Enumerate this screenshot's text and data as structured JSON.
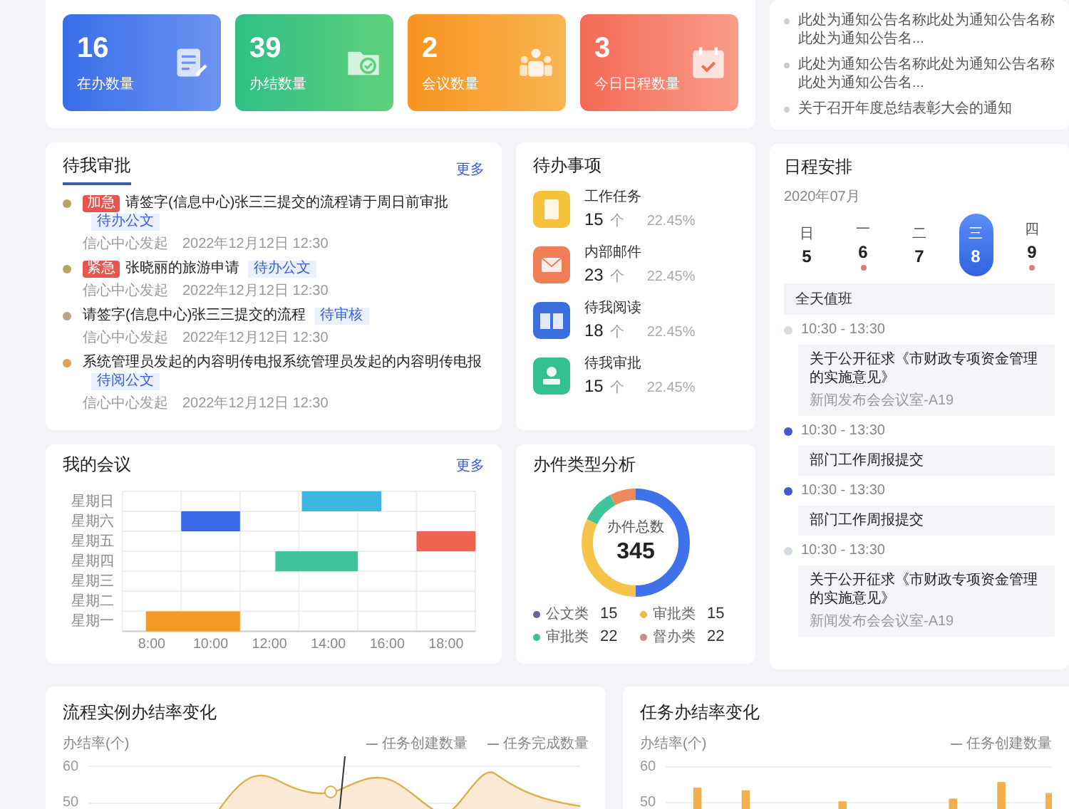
{
  "stats": [
    {
      "kind": "doing",
      "value": "16",
      "label": "在办数量"
    },
    {
      "kind": "done",
      "value": "39",
      "label": "办结数量"
    },
    {
      "kind": "meeting",
      "value": "2",
      "label": "会议数量"
    },
    {
      "kind": "schedule",
      "value": "3",
      "label": "今日日程数量"
    }
  ],
  "notices": [
    {
      "title": "此处为通知公告名称此处为通知公告名称此处为通知公告名..."
    },
    {
      "title": "此处为通知公告名称此处为通知公告名称此处为通知公告名..."
    },
    {
      "title": "关于召开年度总结表彰大会的通知"
    }
  ],
  "approvals": {
    "title": "待我审批",
    "more": "更多",
    "items": [
      {
        "color": "#b5a46a",
        "tag": "加急",
        "title": "请签字(信息中心)张三三提交的流程请于周日前审批",
        "status": "待办公文",
        "source": "信心中心发起",
        "time": "2022年12月12日 12:30"
      },
      {
        "color": "#b5a46a",
        "tag": "紧急",
        "title": "张晓丽的旅游申请",
        "status": "待办公文",
        "source": "信心中心发起",
        "time": "2022年12月12日 12:30"
      },
      {
        "color": "#b8a48a",
        "title": "请签字(信息中心)张三三提交的流程",
        "status": "待审核",
        "source": "信心中心发起",
        "time": "2022年12月12日 12:30"
      },
      {
        "color": "#d9a45a",
        "title": "系统管理员发起的内容明传电报系统管理员发起的内容明传电报",
        "status": "待阅公文",
        "source": "信心中心发起",
        "time": "2022年12月12日 12:30"
      }
    ]
  },
  "todos": {
    "title": "待办事项",
    "items": [
      {
        "kind": "task",
        "name": "工作任务",
        "count": "15",
        "unit": "个",
        "rate": "22.45%"
      },
      {
        "kind": "mail",
        "name": "内部邮件",
        "count": "23",
        "unit": "个",
        "rate": "22.45%"
      },
      {
        "kind": "read",
        "name": "待我阅读",
        "count": "18",
        "unit": "个",
        "rate": "22.45%"
      },
      {
        "kind": "approve",
        "name": "待我审批",
        "count": "15",
        "unit": "个",
        "rate": "22.45%"
      }
    ]
  },
  "schedule": {
    "title": "日程安排",
    "month": "2020年07月",
    "days": [
      {
        "weekday": "日",
        "date": "5",
        "has_event": false,
        "selected": false
      },
      {
        "weekday": "一",
        "date": "6",
        "has_event": true,
        "selected": false
      },
      {
        "weekday": "二",
        "date": "7",
        "has_event": false,
        "selected": false
      },
      {
        "weekday": "三",
        "date": "8",
        "has_event": false,
        "selected": true
      },
      {
        "weekday": "四",
        "date": "9",
        "has_event": true,
        "selected": false
      }
    ],
    "all_day": "全天值班",
    "events": [
      {
        "color": "#d6dae1",
        "time": "10:30 - 13:30",
        "title": "关于公开征求《市财政专项资金管理的实施意见》",
        "place": "新闻发布会会议室-A19"
      },
      {
        "color": "#4a58cf",
        "time": "10:30 - 13:30",
        "title": "部门工作周报提交"
      },
      {
        "color": "#4a58cf",
        "time": "10:30 - 13:30",
        "title": "部门工作周报提交"
      },
      {
        "color": "#d6dae1",
        "time": "10:30 - 13:30",
        "title": "关于公开征求《市财政专项资金管理的实施意见》",
        "place": "新闻发布会会议室-A19"
      }
    ]
  },
  "meetings": {
    "title": "我的会议",
    "more": "更多",
    "days": [
      "星期日",
      "星期六",
      "星期五",
      "星期四",
      "星期三",
      "星期二",
      "星期一"
    ],
    "hours": [
      "8:00",
      "10:00",
      "12:00",
      "14:00",
      "16:00",
      "18:00"
    ]
  },
  "doc_types": {
    "title": "办件类型分析",
    "total_label": "办件总数",
    "total": "345",
    "legend": [
      {
        "name": "公文类",
        "value": "15",
        "color": "#5f6a92"
      },
      {
        "name": "审批类",
        "value": "15",
        "color": "#e9b949"
      },
      {
        "name": "审批类",
        "value": "22",
        "color": "#3fbf95"
      },
      {
        "name": "督办类",
        "value": "22",
        "color": "#c98a8a"
      }
    ]
  },
  "flow_chart": {
    "title": "流程实例办结率变化",
    "ylabel": "办结率(个)",
    "yticks": [
      "60",
      "50"
    ],
    "legend": [
      "任务创建数量",
      "任务完成数量"
    ]
  },
  "task_chart": {
    "title": "任务办结率变化",
    "ylabel": "办结率(个)",
    "yticks": [
      "60",
      "50"
    ],
    "legend": [
      "任务创建数量"
    ]
  }
}
